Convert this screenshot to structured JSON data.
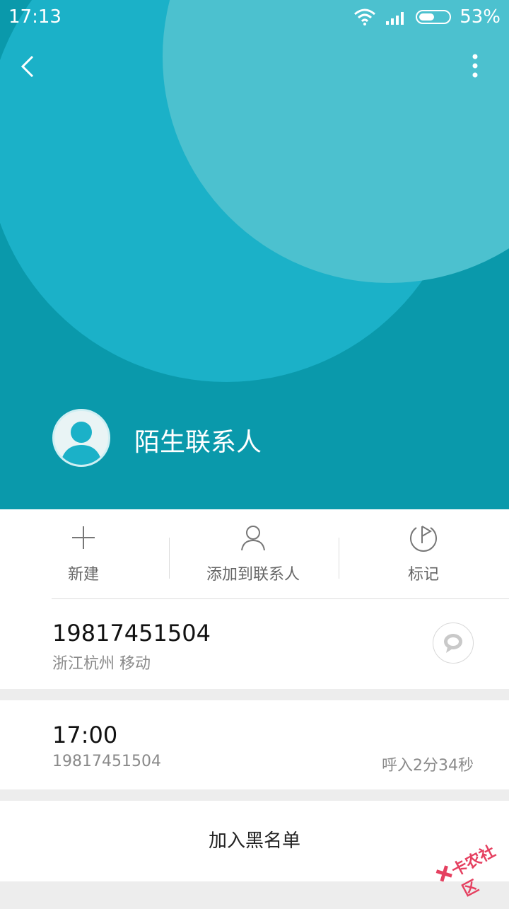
{
  "status_bar": {
    "time": "17:13",
    "battery": "53%",
    "battery_level": 0.53
  },
  "contact": {
    "name": "陌生联系人",
    "phone": "19817451504",
    "location": "浙江杭州 移动"
  },
  "actions": [
    {
      "label": "新建",
      "icon": "plus-icon"
    },
    {
      "label": "添加到联系人",
      "icon": "person-icon"
    },
    {
      "label": "标记",
      "icon": "flag-icon"
    }
  ],
  "call_record": {
    "time": "17:00",
    "number": "19817451504",
    "detail": "呼入2分34秒"
  },
  "blacklist": {
    "label": "加入黑名单"
  },
  "watermark": {
    "text": "卡农社区"
  },
  "colors": {
    "header_dark": "#0a99ab",
    "header_mid": "#1bb1c8",
    "header_light": "#4cc1cf"
  }
}
